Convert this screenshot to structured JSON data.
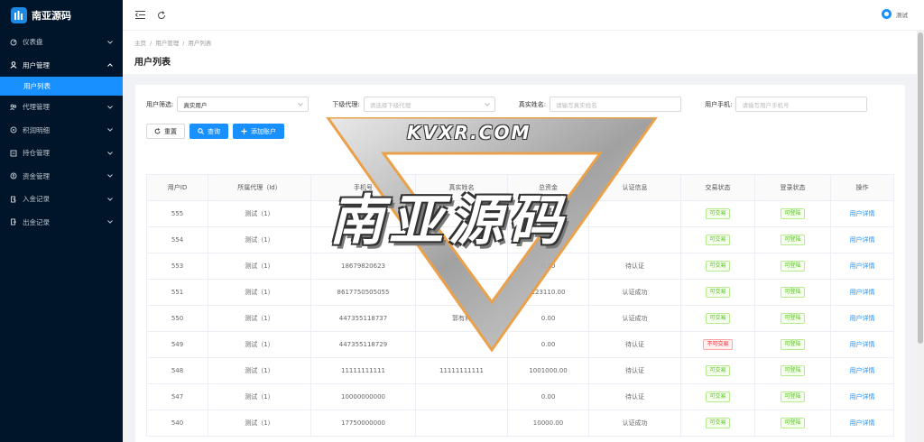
{
  "sidebar": {
    "title": "南亚源码",
    "items": [
      {
        "label": "仪表盘",
        "icon": "dashboard-icon"
      },
      {
        "label": "用户管理",
        "icon": "user-icon",
        "open": true
      },
      {
        "label": "用户列表",
        "active": true
      },
      {
        "label": "代理管理",
        "icon": "agent-icon"
      },
      {
        "label": "积润明细",
        "icon": "detail-icon"
      },
      {
        "label": "持仓管理",
        "icon": "position-icon"
      },
      {
        "label": "资金管理",
        "icon": "money-icon"
      },
      {
        "label": "入金记录",
        "icon": "deposit-icon"
      },
      {
        "label": "出金记录",
        "icon": "withdraw-icon"
      }
    ]
  },
  "header": {
    "user_name": "测试"
  },
  "breadcrumb": [
    "主页",
    "用户管理",
    "用户列表"
  ],
  "page_title": "用户列表",
  "filters": {
    "user_filter_label": "用户筛选:",
    "user_filter_value": "真实用户",
    "agent_label": "下级代理:",
    "agent_placeholder": "请选择下级代理",
    "name_label": "真实姓名:",
    "name_placeholder": "请输写真实姓名",
    "phone_label": "用户手机:",
    "phone_placeholder": "请输写用户手机号"
  },
  "buttons": {
    "reset": "重置",
    "search": "查询",
    "add": "添加账户"
  },
  "table": {
    "headers": [
      "用户ID",
      "所属代理（Id）",
      "手机号",
      "真实姓名",
      "总资金",
      "认证信息",
      "交易状态",
      "登录状态",
      "操作"
    ],
    "rows": [
      [
        "555",
        "测试（1）",
        "",
        "",
        "10000.00",
        "",
        "可交易",
        "可登陆",
        "用户详情"
      ],
      [
        "554",
        "测试（1）",
        "",
        "",
        "",
        "",
        "可交易",
        "可登陆",
        "用户详情"
      ],
      [
        "553",
        "测试（1）",
        "18679820623",
        "",
        "0.00",
        "待认证",
        "可交易",
        "可登陆",
        "用户详情"
      ],
      [
        "551",
        "测试（1）",
        "8617750505055",
        "",
        "123110.00",
        "认证成功",
        "可交易",
        "可登陆",
        "用户详情"
      ],
      [
        "550",
        "测试（1）",
        "447355118737",
        "郭有利",
        "0.00",
        "认证成功",
        "可交易",
        "可登陆",
        "用户详情"
      ],
      [
        "549",
        "测试（1）",
        "447355118729",
        "",
        "0.00",
        "待认证",
        "不可交易",
        "可登陆",
        "用户详情"
      ],
      [
        "548",
        "测试（1）",
        "11111111111",
        "11111111111",
        "1001000.00",
        "待认证",
        "可交易",
        "可登陆",
        "用户详情"
      ],
      [
        "547",
        "测试（1）",
        "10000000000",
        "",
        "0.00",
        "待认证",
        "可交易",
        "可登陆",
        "用户详情"
      ],
      [
        "540",
        "测试（1）",
        "17750000000",
        "",
        "10000.00",
        "认证成功",
        "可交易",
        "可登陆",
        "用户详情"
      ]
    ]
  },
  "watermark": {
    "site": "KVXR.COM",
    "brand": "南亚源码"
  },
  "colors": {
    "sidebar_bg": "#001529",
    "primary": "#1890ff",
    "ok": "#52c41a",
    "danger": "#f5222d"
  }
}
